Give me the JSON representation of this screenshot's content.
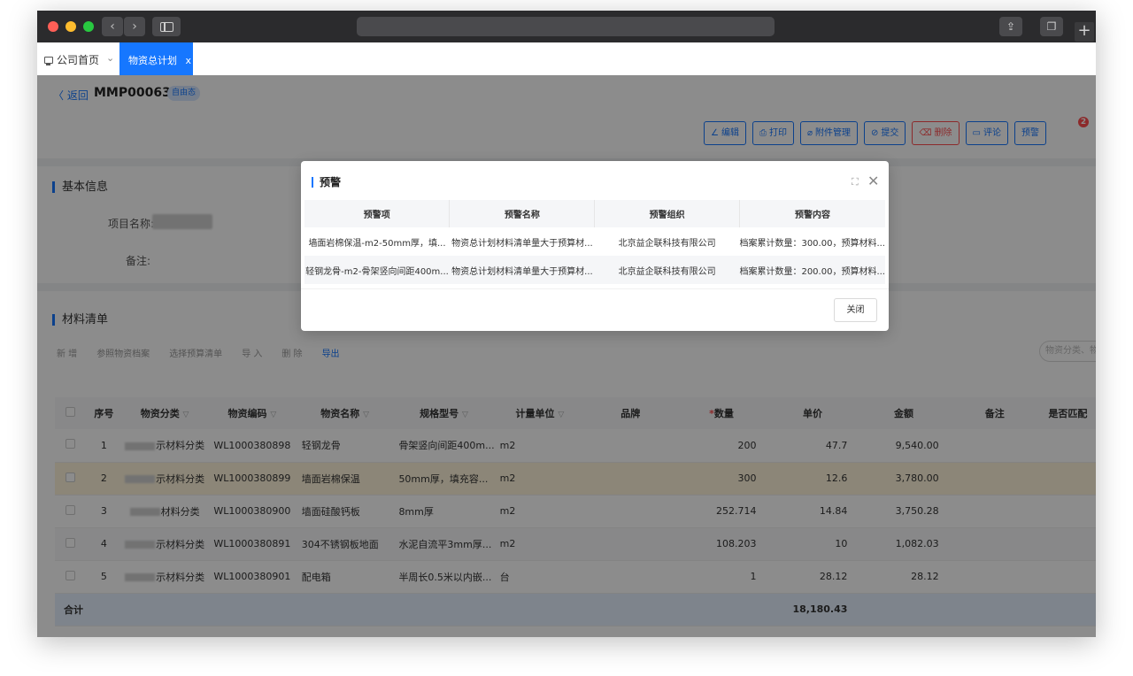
{
  "tabs": {
    "home_label": "公司首页",
    "active_label": "物资总计划",
    "active_close": "x"
  },
  "page": {
    "back_label": "〈 返回",
    "code": "MMP000631",
    "status": "自由态"
  },
  "toolbar": {
    "edit": "编辑",
    "print": "打印",
    "attachments": "附件管理",
    "submit": "提交",
    "delete": "删除",
    "comment": "评论",
    "warning": "预警",
    "warning_badge": "2"
  },
  "basic_info": {
    "title": "基本信息",
    "project_name_label": "项目名称:",
    "remark_label": "备注:"
  },
  "materials": {
    "title": "材料清单",
    "actions": [
      "新 增",
      "参照物资档案",
      "选择预算清单",
      "导 入",
      "删 除",
      "导出"
    ],
    "search_placeholder": "物资分类、物",
    "columns": [
      "序号",
      "物资分类",
      "物资编码",
      "物资名称",
      "规格型号",
      "计量单位",
      "品牌",
      "数量",
      "单价",
      "金额",
      "备注",
      "是否匹配"
    ],
    "rows": [
      {
        "no": "1",
        "category": "示材料分类",
        "code": "WL1000380898",
        "name": "轻钢龙骨",
        "spec": "骨架竖向间距400m...",
        "unit": "m2",
        "brand": "",
        "qty": "200",
        "price": "47.7",
        "amount": "9,540.00"
      },
      {
        "no": "2",
        "category": "示材料分类",
        "code": "WL1000380899",
        "name": "墙面岩棉保温",
        "spec": "50mm厚，填充容...",
        "unit": "m2",
        "brand": "",
        "qty": "300",
        "price": "12.6",
        "amount": "3,780.00"
      },
      {
        "no": "3",
        "category": "材料分类",
        "code": "WL1000380900",
        "name": "墙面硅酸钙板",
        "spec": "8mm厚",
        "unit": "m2",
        "brand": "",
        "qty": "252.714",
        "price": "14.84",
        "amount": "3,750.28"
      },
      {
        "no": "4",
        "category": "示材料分类",
        "code": "WL1000380891",
        "name": "304不锈钢板地面",
        "spec": "水泥自流平3mm厚...",
        "unit": "m2",
        "brand": "",
        "qty": "108.203",
        "price": "10",
        "amount": "1,082.03"
      },
      {
        "no": "5",
        "category": "示材料分类",
        "code": "WL1000380901",
        "name": "配电箱",
        "spec": "半周长0.5米以内嵌...",
        "unit": "台",
        "brand": "",
        "qty": "1",
        "price": "28.12",
        "amount": "28.12"
      }
    ],
    "total_label": "合计",
    "total_amount": "18,180.43"
  },
  "modal": {
    "title": "预警",
    "close_label": "关闭",
    "columns": [
      "预警项",
      "预警名称",
      "预警组织",
      "预警内容"
    ],
    "rows": [
      {
        "item": "墙面岩棉保温-m2-50mm厚，填...",
        "name": "物资总计划材料清单量大于预算材...",
        "org": "北京益企联科技有限公司",
        "content": "档案累计数量：300.00，预算材料..."
      },
      {
        "item": "轻钢龙骨-m2-骨架竖向间距400m...",
        "name": "物资总计划材料清单量大于预算材...",
        "org": "北京益企联科技有限公司",
        "content": "档案累计数量：200.00，预算材料..."
      }
    ]
  },
  "colors": {
    "primary": "#1677ff",
    "danger": "#ff4d4f",
    "highlight_row": "#fff5db"
  }
}
